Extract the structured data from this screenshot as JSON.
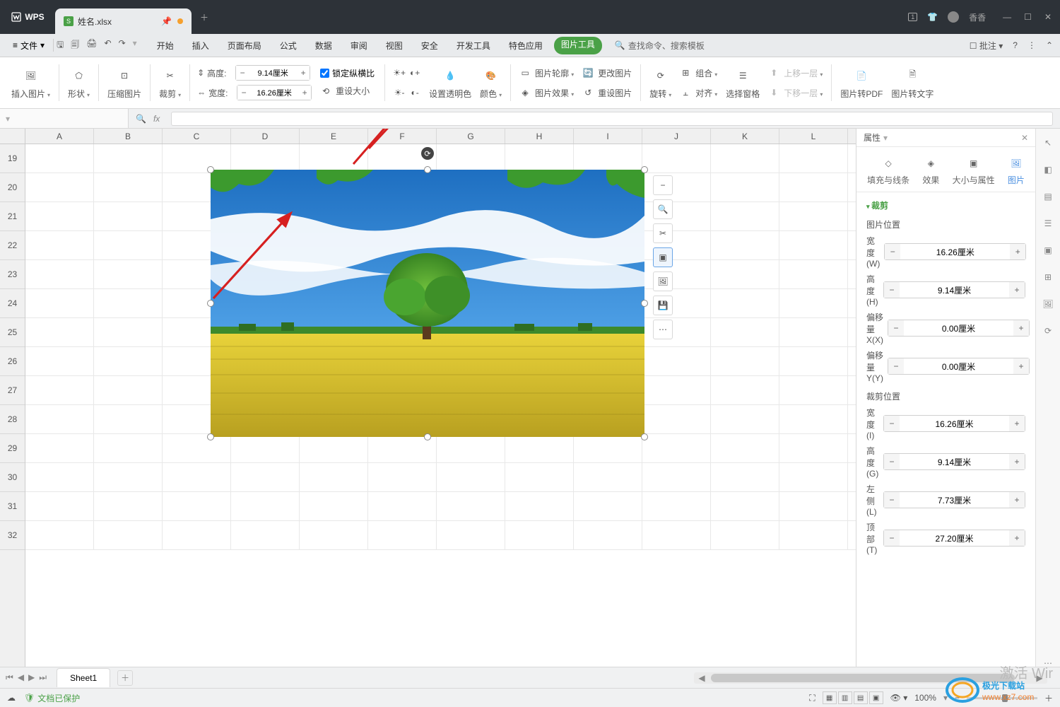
{
  "app": {
    "name": "WPS"
  },
  "tab": {
    "filename": "姓名.xlsx"
  },
  "titlebar": {
    "badge": "1",
    "username": "香香"
  },
  "menubar": {
    "file": "文件",
    "menus": [
      "开始",
      "插入",
      "页面布局",
      "公式",
      "数据",
      "审阅",
      "视图",
      "安全",
      "开发工具",
      "特色应用"
    ],
    "picture_tools": "图片工具",
    "search": "查找命令、搜索模板",
    "comment": "批注"
  },
  "ribbon": {
    "insert_image": "插入图片",
    "shape": "形状",
    "compress": "压缩图片",
    "crop": "裁剪",
    "height": "高度:",
    "width": "宽度:",
    "height_val": "9.14厘米",
    "width_val": "16.26厘米",
    "lock_ratio": "锁定纵横比",
    "reset_size": "重设大小",
    "transparent": "设置透明色",
    "color": "颜色",
    "outline": "图片轮廓",
    "effect": "图片效果",
    "change": "更改图片",
    "reset_pic": "重设图片",
    "rotate": "旋转",
    "group": "组合",
    "align": "对齐",
    "sel_pane": "选择窗格",
    "up_layer": "上移一层",
    "down_layer": "下移一层",
    "to_pdf": "图片转PDF",
    "to_text": "图片转文字"
  },
  "columns": [
    "A",
    "B",
    "C",
    "D",
    "E",
    "F",
    "G",
    "H",
    "I",
    "J",
    "K",
    "L"
  ],
  "rows": [
    "19",
    "20",
    "21",
    "22",
    "23",
    "24",
    "25",
    "26",
    "27",
    "28",
    "29",
    "30",
    "31",
    "32"
  ],
  "prop": {
    "title": "属性",
    "tabs": {
      "fill": "填充与线条",
      "effect": "效果",
      "size": "大小与属性",
      "pic": "图片"
    },
    "crop": "裁剪",
    "pic_pos": "图片位置",
    "crop_pos": "裁剪位置",
    "w": "宽度(W)",
    "h": "高度(H)",
    "ox": "偏移量 X(X)",
    "oy": "偏移量 Y(Y)",
    "wi": "宽度(I)",
    "hg": "高度(G)",
    "lf": "左侧(L)",
    "tp": "顶部(T)",
    "vals": {
      "w": "16.26厘米",
      "h": "9.14厘米",
      "ox": "0.00厘米",
      "oy": "0.00厘米",
      "wi": "16.26厘米",
      "hg": "9.14厘米",
      "lf": "7.73厘米",
      "tp": "27.20厘米"
    }
  },
  "sheet": {
    "name": "Sheet1"
  },
  "status": {
    "protect": "文档已保护",
    "zoom": "100%"
  },
  "watermark": "激活 Wir",
  "site": {
    "name": "极光下载站",
    "url": "www.xz7.com"
  }
}
